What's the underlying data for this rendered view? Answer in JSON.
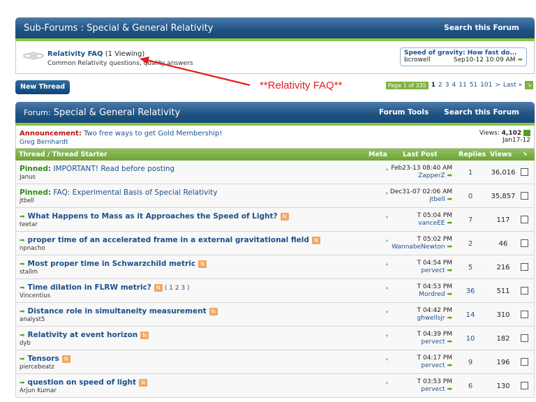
{
  "subforums": {
    "title": "Sub-Forums : Special & General Relativity",
    "search": "Search this Forum"
  },
  "faq": {
    "title": "Relativity FAQ",
    "viewing": "(1 Viewing)",
    "desc": "Common Relativity questions, quality answers"
  },
  "lastpost_box": {
    "title": "Speed of gravity: How fast do...",
    "user": "bcrowell",
    "date": "Sep10-12 10:09 AM"
  },
  "annotation": {
    "text": "**Relativity FAQ**",
    "color": "#e31c1c"
  },
  "new_thread": "New Thread",
  "pager": {
    "label": "Page 1 of 335",
    "current": "1",
    "pages": [
      "2",
      "3",
      "4",
      "11",
      "51",
      "101",
      ">",
      "Last »"
    ]
  },
  "forum": {
    "label": "Forum:",
    "title": "Special & General Relativity",
    "tools": "Forum Tools",
    "search": "Search this Forum"
  },
  "announcement": {
    "label": "Announcement:",
    "text": "Two free ways to get Gold Membership!",
    "author": "Greg Bernhardt",
    "views_label": "Views:",
    "views": "4,102",
    "date": "Jan17-12"
  },
  "columns": {
    "thread": "Thread / Thread Starter",
    "meta": "Meta",
    "lastpost": "Last Post",
    "replies": "Replies",
    "views": "Views"
  },
  "threads": [
    {
      "pinned": "Pinned:",
      "title": "IMPORTANT! Read before posting",
      "starter": "Janus",
      "date": "Feb23-13 08:40 AM",
      "user": "ZapperZ",
      "replies": "1",
      "views": "36,016"
    },
    {
      "pinned": "Pinned:",
      "title": "FAQ: Experimental Basis of Special Relativity",
      "starter": "jtbell",
      "date": "Dec31-07 02:06 AM",
      "user": "jtbell",
      "replies": "0",
      "views": "35,857"
    },
    {
      "title": "What Happens to Mass as it Approaches the Speed of Light?",
      "starter": "teetar",
      "date": "T 05:04 PM",
      "user": "vanceEE",
      "replies": "7",
      "views": "117"
    },
    {
      "title": "proper time of an accelerated frame in a external gravitational field",
      "starter": "npnacho",
      "date": "T 05:02 PM",
      "user": "WannabeNewton",
      "replies": "2",
      "views": "46"
    },
    {
      "title": "Most proper time in Schwarzchild metric",
      "starter": "stallm",
      "date": "T 04:54 PM",
      "user": "pervect",
      "replies": "5",
      "views": "216"
    },
    {
      "title": "Time dilation in FLRW metric?",
      "pages": "( 1 2 3 )",
      "starter": "Vincentius",
      "date": "T 04:53 PM",
      "user": "Mordred",
      "replies": "36",
      "views": "511"
    },
    {
      "title": "Distance role in simultaneity measurement",
      "starter": "analyst5",
      "date": "T 04:42 PM",
      "user": "ghwellsjr",
      "replies": "14",
      "views": "310"
    },
    {
      "title": "Relativity at event horizon",
      "starter": "dyb",
      "date": "T 04:39 PM",
      "user": "pervect",
      "replies": "10",
      "views": "182"
    },
    {
      "title": "Tensors",
      "starter": "piercebeatz",
      "date": "T 04:17 PM",
      "user": "pervect",
      "replies": "9",
      "views": "196"
    },
    {
      "title": "question on speed of light",
      "starter": "Arjun Kumar",
      "date": "T 03:53 PM",
      "user": "pervect",
      "replies": "6",
      "views": "130"
    }
  ]
}
